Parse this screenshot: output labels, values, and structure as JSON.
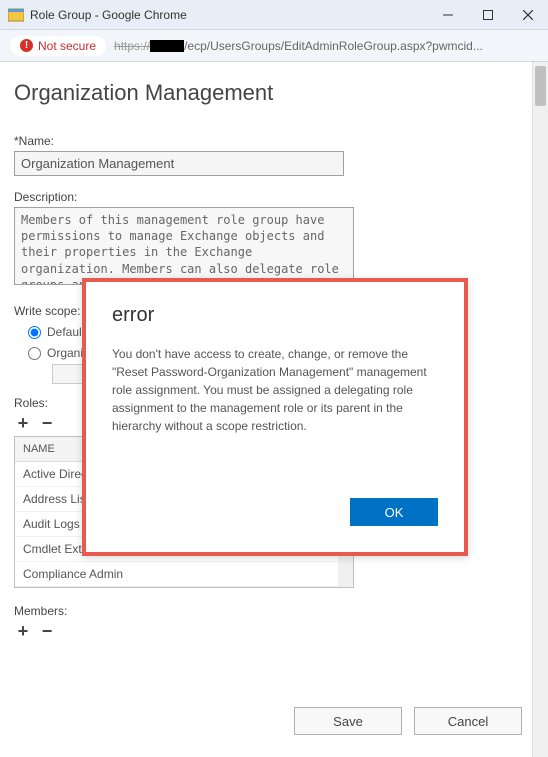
{
  "window": {
    "title": "Role Group - Google Chrome"
  },
  "address": {
    "not_secure": "Not secure",
    "url_prefix": "https://",
    "url_path": "/ecp/UsersGroups/EditAdminRoleGroup.aspx?pwmcid..."
  },
  "page": {
    "heading": "Organization Management",
    "name_label": "Name:",
    "name_value": "Organization Management",
    "description_label": "Description:",
    "description_value": "Members of this management role group have permissions to manage Exchange objects and their properties in the Exchange organization. Members can also delegate role groups and management roles in the organization. This role group shouldn't be deleted.",
    "write_scope_label": "Write scope:",
    "scope_default": "Default",
    "scope_org": "Organizational unit:",
    "roles_label": "Roles:",
    "members_label": "Members:",
    "list_header": "NAME",
    "roles": [
      "Active Directory Permissions",
      "Address Lists",
      "Audit Logs",
      "Cmdlet Extension Agents",
      "Compliance Admin"
    ],
    "save": "Save",
    "cancel": "Cancel"
  },
  "modal": {
    "title": "error",
    "message": "You don't have access to create, change, or remove the \"Reset Password-Organization Management\" management role assignment. You must be assigned a delegating role assignment to the management role or its parent in the hierarchy without a scope restriction.",
    "ok": "OK"
  }
}
